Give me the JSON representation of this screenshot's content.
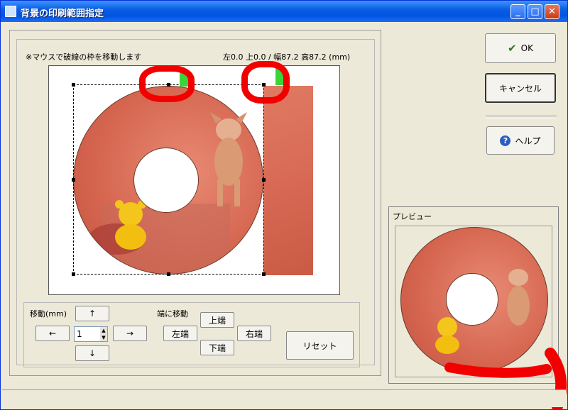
{
  "window": {
    "title": "背景の印刷範囲指定"
  },
  "canvas_area": {
    "hint": "※マウスで破線の枠を移動します",
    "coords": "左0.0 上0.0 / 幅87.2 高87.2 (mm)"
  },
  "move": {
    "label": "移動(mm)",
    "up": "↑",
    "down": "↓",
    "left": "←",
    "right": "→",
    "step_value": "1"
  },
  "edge": {
    "label": "端に移動",
    "top": "上端",
    "bottom": "下端",
    "left": "左端",
    "right": "右端"
  },
  "reset_label": "リセット",
  "actions": {
    "ok": "OK",
    "cancel": "キャンセル",
    "help": "ヘルプ"
  },
  "preview": {
    "label": "プレビュー"
  },
  "colors": {
    "titlebar": "#0054E3",
    "annotation": "#F20000",
    "highlight": "#39D33A"
  },
  "icons": [
    "app-icon",
    "minimize-icon",
    "maximize-icon",
    "close-icon",
    "checkmark-icon",
    "help-icon"
  ]
}
